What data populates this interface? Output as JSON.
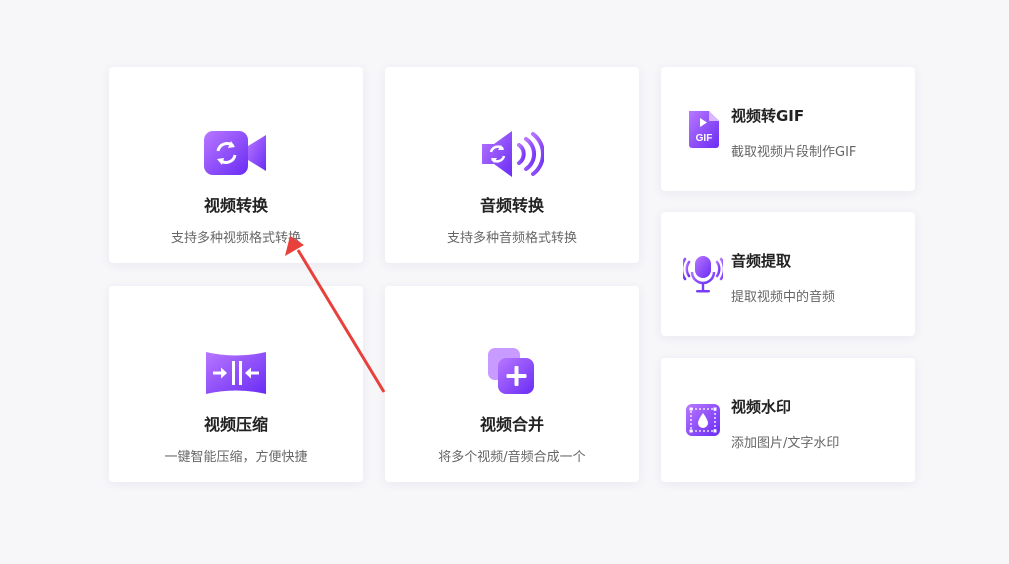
{
  "accent_colors": {
    "start": "#b06cff",
    "end": "#6a2cf5",
    "arrow": "#e8403a"
  },
  "cards": {
    "video_convert": {
      "title": "视频转换",
      "desc": "支持多种视频格式转换",
      "icon": "video-convert-icon"
    },
    "audio_convert": {
      "title": "音频转换",
      "desc": "支持多种音频格式转换",
      "icon": "audio-convert-icon"
    },
    "video_gif": {
      "title": "视频转GIF",
      "desc": "截取视频片段制作GIF",
      "icon": "gif-file-icon",
      "icon_text": "GIF"
    },
    "audio_extract": {
      "title": "音频提取",
      "desc": "提取视频中的音频",
      "icon": "microphone-icon"
    },
    "video_compress": {
      "title": "视频压缩",
      "desc": "一键智能压缩，方便快捷",
      "icon": "compress-icon"
    },
    "video_merge": {
      "title": "视频合并",
      "desc": "将多个视频/音频合成一个",
      "icon": "merge-plus-icon"
    },
    "video_watermark": {
      "title": "视频水印",
      "desc": "添加图片/文字水印",
      "icon": "watermark-icon"
    }
  }
}
